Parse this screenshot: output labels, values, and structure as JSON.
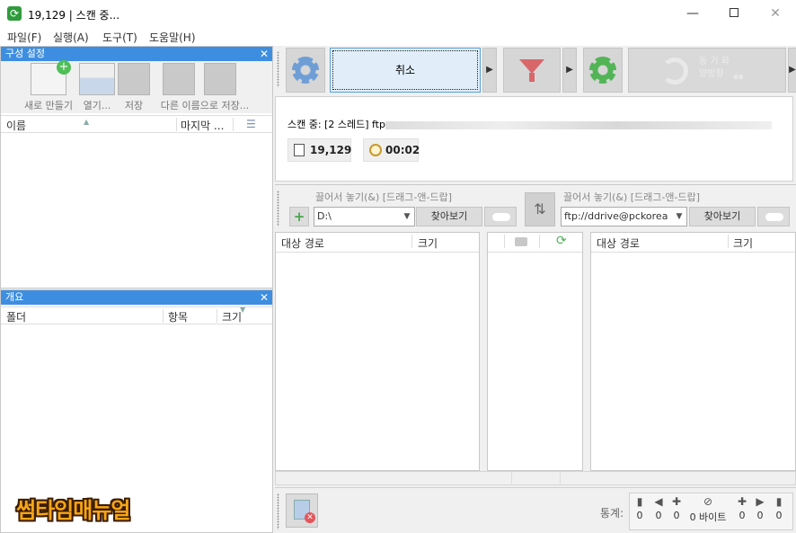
{
  "window": {
    "title": "19,129 | 스캔 중...",
    "minimize_label": "—",
    "close_label": "✕"
  },
  "menu": {
    "items": [
      "파일(F)",
      "실행(A)",
      "도구(T)",
      "도움말(H)"
    ]
  },
  "config_panel": {
    "title": "구성 설정",
    "close_label": "✕",
    "buttons": [
      "새로 만들기",
      "열기...",
      "저장",
      "다른 이름으로 저장..."
    ],
    "columns": [
      "이름",
      "마지막 ..."
    ]
  },
  "overview_panel": {
    "title": "개요",
    "close_label": "✕",
    "columns": [
      "폴더",
      "항목",
      "크기"
    ]
  },
  "toolbar": {
    "cancel_label": "취소",
    "sync_label_top": "동 기 화",
    "sync_label_bottom": "양방향",
    "sync_arrows": "⇔"
  },
  "scan": {
    "status_prefix": "스캔 중: [2 스레드] ftp",
    "item_count": "19,129",
    "elapsed": "00:02"
  },
  "pair": {
    "left_drop_label": "끌어서 놓기(&) [드래그-앤-드랍]",
    "right_drop_label": "끌어서 놓기(&) [드래그-앤-드랍]",
    "left_path": "D:\\",
    "right_path": "ftp://ddrive@pckorea",
    "browse_label": "찾아보기"
  },
  "grids": {
    "left_columns": [
      "대상 경로",
      "크기"
    ],
    "right_columns": [
      "대상 경로",
      "크기"
    ]
  },
  "stats": {
    "label": "통계:",
    "values": [
      "0",
      "0",
      "0",
      "0 바이트",
      "0",
      "0",
      "0"
    ]
  },
  "watermark": "썸타임매뉴얼",
  "colors": {
    "panel_header": "#3d8ee1",
    "cancel_button_bg": "#e1eefa",
    "filter_red": "#d9676a",
    "gear_green": "#52b457",
    "gear_blue": "#6f9ed6"
  }
}
